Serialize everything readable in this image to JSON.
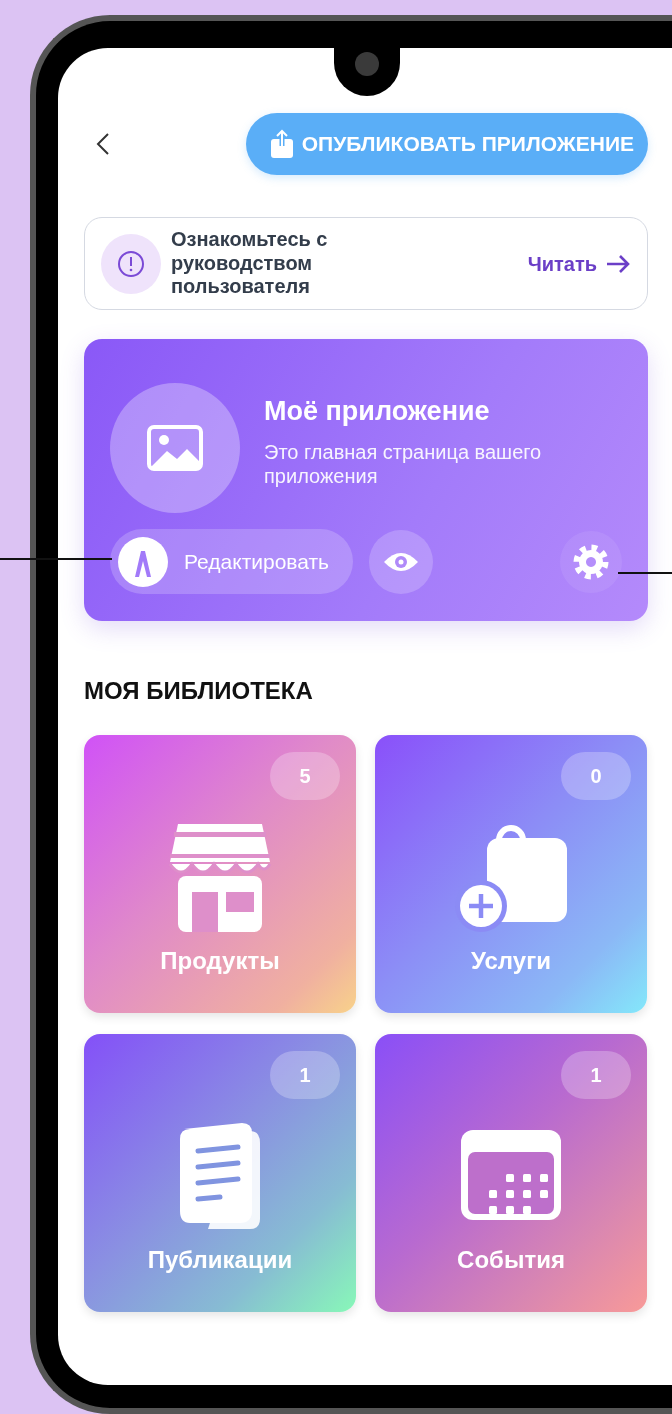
{
  "header": {
    "publish_button": "ОПУБЛИКОВАТЬ ПРИЛОЖЕНИЕ"
  },
  "guide_banner": {
    "text": "Ознакомьтесь с руководством пользователя",
    "link": "Читать"
  },
  "app_card": {
    "title": "Моё приложение",
    "subtitle": "Это главная страница вашего приложения",
    "edit_button": "Редактировать"
  },
  "library": {
    "heading": "МОЯ БИБЛИОТЕКА",
    "tiles": [
      {
        "kind": "store",
        "label": "Продукты",
        "count": "5"
      },
      {
        "kind": "services",
        "label": "Услуги",
        "count": "0"
      },
      {
        "kind": "posts",
        "label": "Публикации",
        "count": "1"
      },
      {
        "kind": "events",
        "label": "События",
        "count": "1"
      }
    ]
  }
}
